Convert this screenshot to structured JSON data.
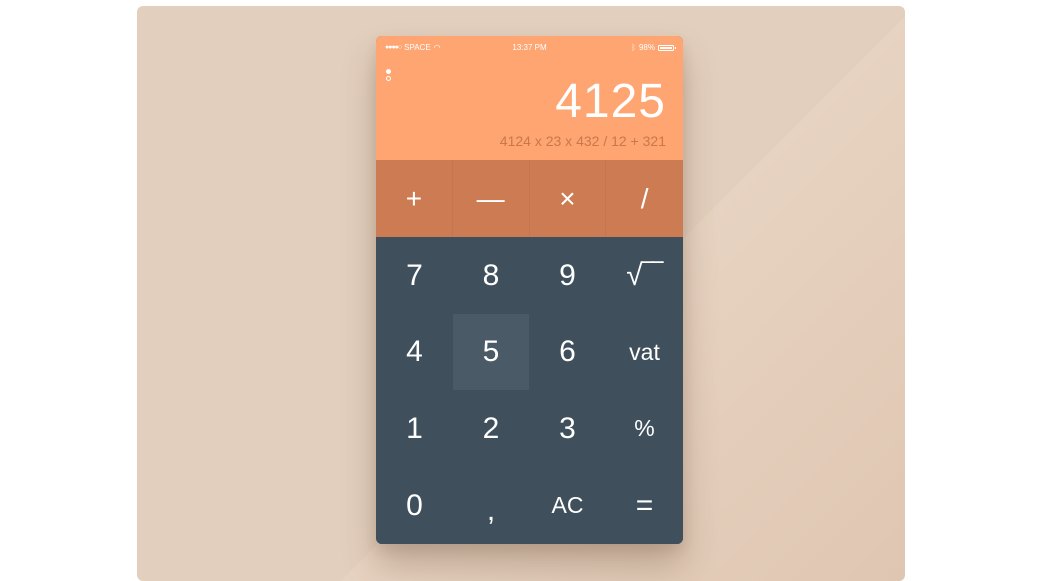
{
  "status_bar": {
    "carrier": "SPACE",
    "signal": "●●●●○",
    "wifi_icon": "wifi-icon",
    "time": "13:37 PM",
    "bluetooth_icon": "bluetooth-icon",
    "battery_percent": "98%"
  },
  "menu_icon": "more-options-icon",
  "display": {
    "result": "4125",
    "expression": "4124 x 23 x 432 / 12 + 321"
  },
  "operators": [
    "+",
    "—",
    "×",
    "/"
  ],
  "keypad": {
    "rows": [
      [
        "7",
        "8",
        "9",
        "√‾‾"
      ],
      [
        "4",
        "5",
        "6",
        "vat"
      ],
      [
        "1",
        "2",
        "3",
        "%"
      ],
      [
        "0",
        ",",
        "AC",
        "="
      ]
    ],
    "pressed_key": "5"
  },
  "colors": {
    "display_bg": "#fea572",
    "operators_bg": "#cc7b53",
    "keypad_bg": "#3f505c",
    "pressed_key_bg": "#4a5b67",
    "page_bg": "#e3cfbd"
  }
}
